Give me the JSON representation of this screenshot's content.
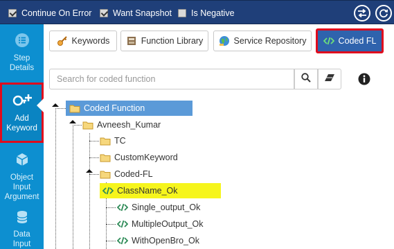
{
  "toolbar": {
    "options": [
      {
        "label": "Continue On Error",
        "checked": true
      },
      {
        "label": "Want Snapshot",
        "checked": true
      },
      {
        "label": "Is Negative",
        "checked": false
      }
    ],
    "icons": [
      "swap-icon",
      "refresh-icon"
    ]
  },
  "sidebar": {
    "items": [
      {
        "label_line1": "Step",
        "label_line2": "Details",
        "icon": "list-icon"
      },
      {
        "label_line1": "Add",
        "label_line2": "Keyword",
        "icon": "add-key-icon",
        "active": true
      },
      {
        "label_line1": "Object",
        "label_line2": "Input",
        "label_line3": "Argument",
        "icon": "cube-icon"
      },
      {
        "label_line1": "Data",
        "label_line2": "Input",
        "icon": "data-icon"
      }
    ]
  },
  "tabs": [
    {
      "label": "Keywords",
      "icon": "key-icon"
    },
    {
      "label": "Function Library",
      "icon": "book-icon"
    },
    {
      "label": "Service Repository",
      "icon": "globe-icon"
    },
    {
      "label": "Coded FL",
      "icon": "code-icon",
      "active": true
    }
  ],
  "search": {
    "placeholder": "Search for coded function"
  },
  "tree": {
    "root": "Coded Function",
    "user": "Avneesh_Kumar",
    "folders": [
      "TC",
      "CustomKeyword",
      "Coded-FL"
    ],
    "functions": [
      "ClassName_Ok",
      "Single_output_Ok",
      "MultipleOutput_Ok",
      "WithOpenBro_Ok"
    ],
    "selected": "ClassName_Ok"
  },
  "colors": {
    "topbar": "#1f3f79",
    "sidebar": "#0d8fd0",
    "active_tab": "#2f63ad",
    "highlight_border": "#e00b1d",
    "root_node": "#5b9ad8",
    "selected_node": "#f6f51c",
    "code_icon": "#2e8b57"
  }
}
